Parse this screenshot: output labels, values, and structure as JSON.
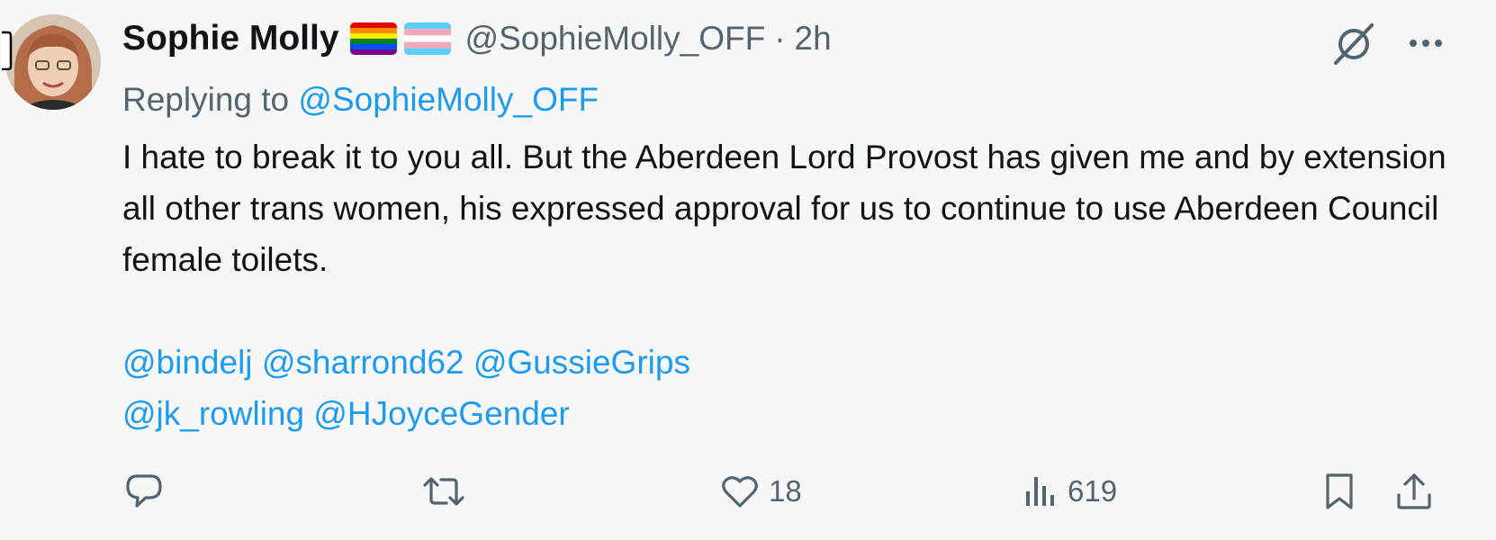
{
  "author": {
    "name": "Sophie Molly",
    "handle": "@SophieMolly_OFF",
    "separator": "·",
    "time": "2h",
    "flags": [
      "rainbow-pride-flag",
      "transgender-flag"
    ]
  },
  "reply": {
    "prefix": "Replying to",
    "handle": "@SophieMolly_OFF"
  },
  "body": {
    "text": "I hate to break it to you all. But the Aberdeen Lord Provost has given me and by extension all other trans women, his expressed approval for us to continue to use Aberdeen Council female toilets."
  },
  "mentions": {
    "line1": [
      "@bindelj",
      "@sharrond62",
      "@GussieGrips"
    ],
    "line2": [
      "@jk_rowling",
      "@HJoyceGender"
    ]
  },
  "actions": {
    "reply_icon": "speech-bubble-icon",
    "retweet_icon": "retweet-icon",
    "like_icon": "heart-icon",
    "like_count": "18",
    "views_icon": "bar-chart-icon",
    "views_count": "619",
    "bookmark_icon": "bookmark-icon",
    "share_icon": "share-icon"
  },
  "colors": {
    "text": "#0f1419",
    "secondary": "#536471",
    "link": "#1d9bf0",
    "background": "#f7f7f7"
  }
}
